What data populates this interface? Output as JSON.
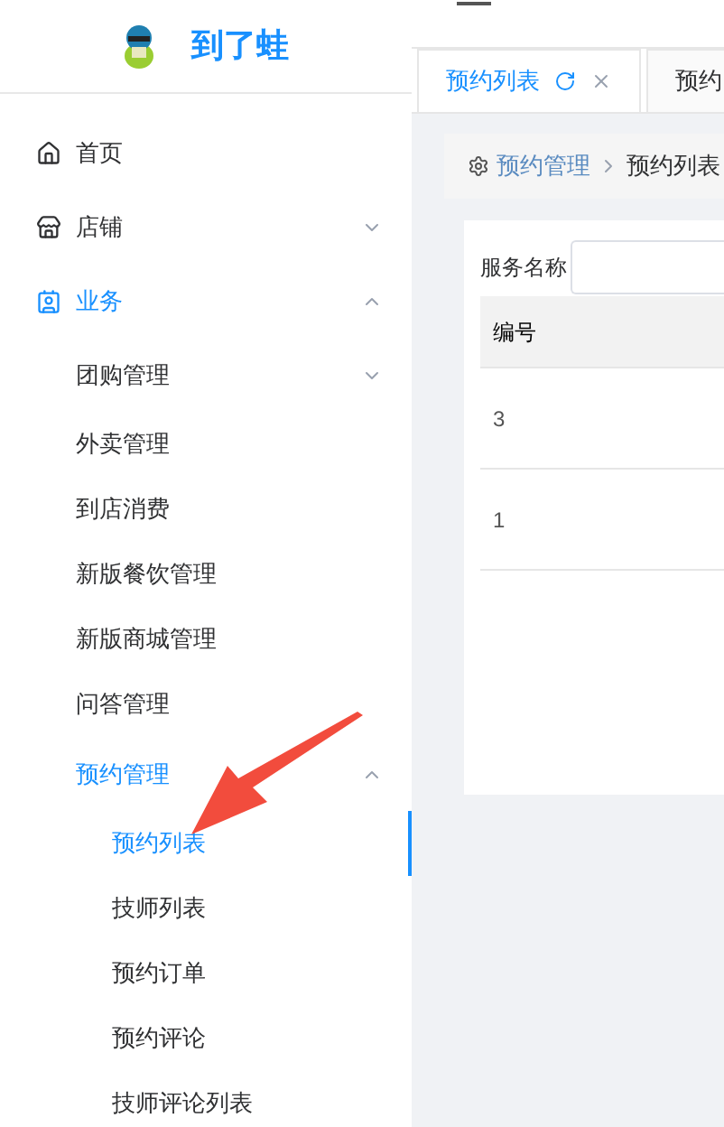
{
  "sidebar": {
    "logo_text": "到了蛙",
    "items": [
      {
        "label": "首页",
        "kind": "home",
        "selected": false
      },
      {
        "label": "店铺",
        "kind": "shop",
        "expanded": false,
        "selected": false
      },
      {
        "label": "业务",
        "kind": "business",
        "expanded": true,
        "selected": true,
        "children": [
          {
            "label": "团购管理",
            "expanded": false,
            "selected": false
          },
          {
            "label": "外卖管理",
            "selected": false
          },
          {
            "label": "到店消费",
            "selected": false
          },
          {
            "label": "新版餐饮管理",
            "selected": false
          },
          {
            "label": "新版商城管理",
            "selected": false
          },
          {
            "label": "问答管理",
            "selected": false
          },
          {
            "label": "预约管理",
            "expanded": true,
            "selected": true,
            "children": [
              {
                "label": "预约列表",
                "selected": true
              },
              {
                "label": "技师列表",
                "selected": false
              },
              {
                "label": "预约订单",
                "selected": false
              },
              {
                "label": "预约评论",
                "selected": false
              },
              {
                "label": "技师评论列表",
                "selected": false
              }
            ]
          }
        ]
      }
    ]
  },
  "tabs": [
    {
      "label": "预约列表",
      "selected": true
    },
    {
      "label": "预约",
      "selected": false
    }
  ],
  "breadcrumb": [
    "预约管理",
    "预约列表"
  ],
  "search": {
    "label": "服务名称"
  },
  "table": {
    "columns": [
      "编号"
    ],
    "rows": [
      [
        "3"
      ],
      [
        "1"
      ]
    ]
  }
}
